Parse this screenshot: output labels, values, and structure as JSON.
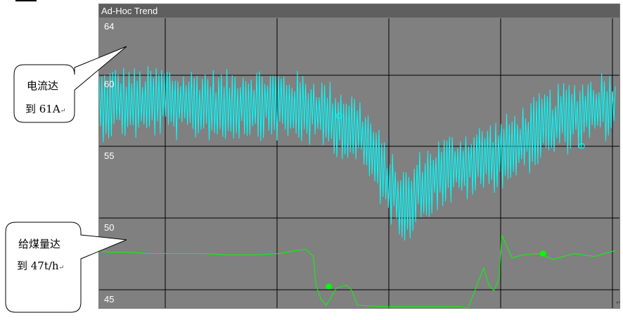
{
  "window": {
    "title": "Ad-Hoc Trend"
  },
  "chart_data": {
    "type": "line",
    "title": "Ad-Hoc Trend",
    "ylim": [
      44.4,
      64.6
    ],
    "y_ticks": [
      "64",
      "60",
      "55",
      "50",
      "45"
    ],
    "grid": true,
    "background": "#808080",
    "grid_color": "#000000",
    "series": [
      {
        "color": "#00ffff",
        "noisy": true,
        "x": [
          0,
          0.04,
          0.08,
          0.12,
          0.16,
          0.2,
          0.24,
          0.28,
          0.32,
          0.36,
          0.4,
          0.44,
          0.48,
          0.5,
          0.52,
          0.54,
          0.56,
          0.58,
          0.6,
          0.62,
          0.66,
          0.7,
          0.74,
          0.78,
          0.82,
          0.86,
          0.9,
          0.94,
          0.98,
          1.0
        ],
        "y": [
          58.5,
          58.8,
          58.6,
          58.9,
          58.5,
          58.7,
          58.4,
          58.8,
          58.6,
          58.5,
          58.3,
          57.8,
          57.2,
          56.8,
          55.8,
          54.5,
          53.0,
          52.0,
          51.5,
          52.8,
          53.8,
          54.3,
          54.7,
          55.2,
          56.0,
          57.0,
          57.6,
          58.0,
          58.5,
          58.6
        ],
        "amplitude": 2.6
      },
      {
        "color": "#00ff00",
        "noisy": false,
        "x": [
          0,
          0.02,
          0.05,
          0.1,
          0.15,
          0.2,
          0.25,
          0.3,
          0.35,
          0.38,
          0.4,
          0.415,
          0.42,
          0.43,
          0.44,
          0.45,
          0.46,
          0.48,
          0.49,
          0.5,
          0.55,
          0.6,
          0.65,
          0.7,
          0.715,
          0.73,
          0.745,
          0.755,
          0.765,
          0.775,
          0.78,
          0.8,
          0.82,
          0.85,
          0.88,
          0.92,
          0.96,
          1.0
        ],
        "y": [
          48.4,
          48.3,
          48.3,
          48.2,
          48.2,
          48.2,
          48.1,
          48.1,
          48.2,
          48.4,
          48.5,
          48.0,
          46.0,
          45.0,
          44.6,
          45.2,
          45.8,
          46.0,
          45.6,
          44.6,
          44.5,
          44.5,
          44.5,
          44.5,
          44.4,
          45.8,
          47.2,
          46.0,
          45.6,
          46.5,
          49.5,
          47.9,
          48.1,
          48.2,
          47.8,
          48.2,
          48.0,
          48.4
        ]
      }
    ],
    "markers": [
      {
        "series": 0,
        "x": 0.465,
        "y": 57.8,
        "symbol": "open-circle",
        "color": "#00ffff"
      },
      {
        "series": 0,
        "x": 0.935,
        "y": 55.7,
        "symbol": "open-circle",
        "color": "#00ffff"
      },
      {
        "series": 1,
        "x": 0.445,
        "y": 45.9,
        "symbol": "filled-dot",
        "color": "#00ff00"
      },
      {
        "series": 1,
        "x": 0.86,
        "y": 48.2,
        "symbol": "filled-dot",
        "color": "#00ff00"
      }
    ],
    "annotations": [
      {
        "lines": [
          "电流达",
          "到 61A"
        ],
        "points_to_series": 0
      },
      {
        "lines": [
          "给煤量达",
          "到 47t/h"
        ],
        "points_to_series": 1
      }
    ]
  },
  "return_mark": "↵"
}
